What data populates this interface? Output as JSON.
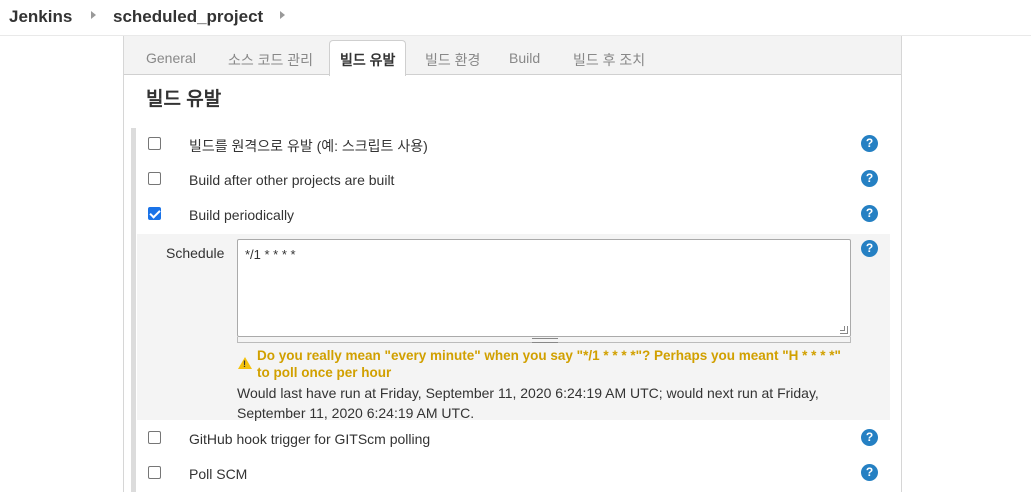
{
  "breadcrumb": {
    "items": [
      "Jenkins",
      "scheduled_project"
    ]
  },
  "tabs": [
    {
      "label": "General",
      "active": false
    },
    {
      "label": "소스 코드 관리",
      "active": false
    },
    {
      "label": "빌드 유발",
      "active": true
    },
    {
      "label": "빌드 환경",
      "active": false
    },
    {
      "label": "Build",
      "active": false
    },
    {
      "label": "빌드 후 조치",
      "active": false
    }
  ],
  "section": {
    "title": "빌드 유발"
  },
  "triggers": [
    {
      "label": "빌드를 원격으로 유발 (예: 스크립트 사용)",
      "checked": false
    },
    {
      "label": "Build after other projects are built",
      "checked": false
    },
    {
      "label": "Build periodically",
      "checked": true
    },
    {
      "label": "GitHub hook trigger for GITScm polling",
      "checked": false
    },
    {
      "label": "Poll SCM",
      "checked": false
    }
  ],
  "schedule": {
    "label": "Schedule",
    "value": "*/1 * * * *",
    "warning": "Do you really mean \"every minute\" when you say \"*/1 * * * *\"? Perhaps you meant \"H * * * *\" to poll once per hour",
    "info": "Would last have run at Friday, September 11, 2020 6:24:19 AM UTC; would next run at Friday, September 11, 2020 6:24:19 AM UTC."
  },
  "help": {
    "glyph": "?"
  },
  "colors": {
    "accent": "#2580c3",
    "checkbox_checked": "#1a73e8",
    "warning": "#d1a000"
  },
  "icons": {
    "help": "question-circle-icon",
    "warning": "warning-triangle-icon",
    "breadcrumb_separator": "chevron-right-icon"
  }
}
